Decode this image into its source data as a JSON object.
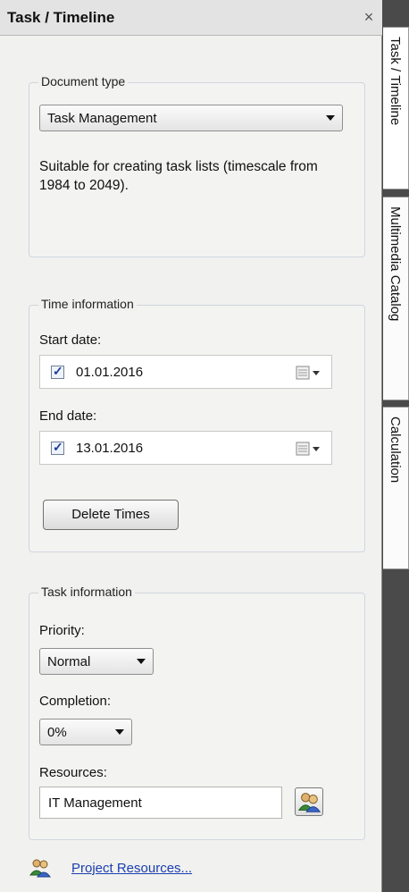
{
  "panel": {
    "title": "Task / Timeline",
    "close_glyph": "×"
  },
  "document_type": {
    "legend": "Document type",
    "selected": "Task Management",
    "description": "Suitable for creating task lists (timescale from 1984 to 2049)."
  },
  "time_info": {
    "legend": "Time information",
    "start_label": "Start date:",
    "start_value": "01.01.2016",
    "start_checked": true,
    "end_label": "End date:",
    "end_value": "13.01.2016",
    "end_checked": true,
    "delete_button": "Delete Times"
  },
  "task_info": {
    "legend": "Task information",
    "priority_label": "Priority:",
    "priority_value": "Normal",
    "completion_label": "Completion:",
    "completion_value": "0%",
    "resources_label": "Resources:",
    "resources_value": "IT Management"
  },
  "footer": {
    "link": "Project Resources..."
  },
  "tabs": [
    {
      "label": "Task / Timeline",
      "active": true
    },
    {
      "label": "Multimedia Catalog",
      "active": false
    },
    {
      "label": "Calculation",
      "active": false
    }
  ],
  "colors": {
    "link": "#1a3fb0",
    "dark_background": "#4a4a4a"
  }
}
